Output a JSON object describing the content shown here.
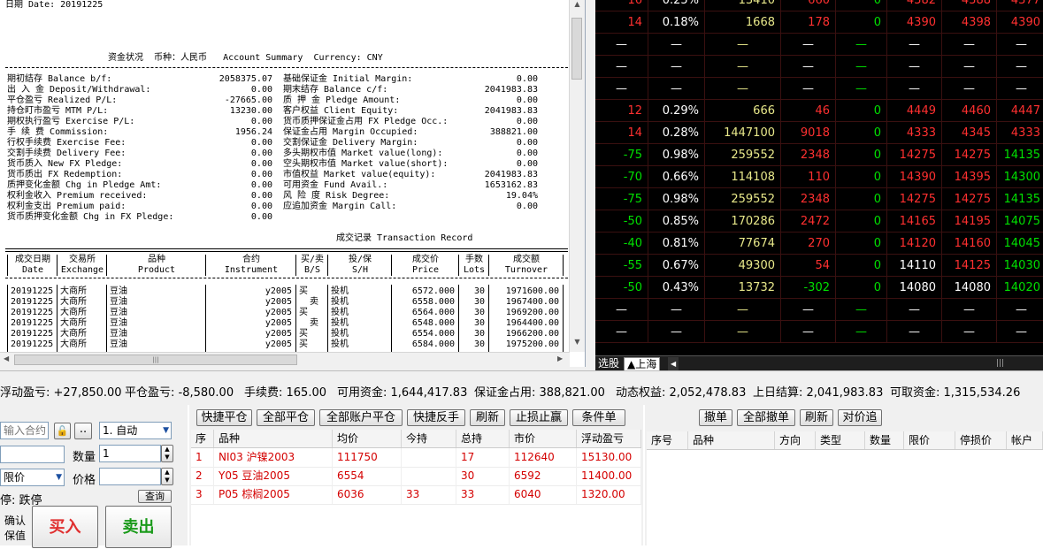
{
  "statement": {
    "date_line": "日期 Date: 20191225",
    "summary_title": "资金状况  币种：人民币   Account Summary  Currency: CNY",
    "left_rows": [
      {
        "label": "期初结存 Balance b/f:",
        "value": "2058375.07"
      },
      {
        "label": "出 入 金 Deposit/Withdrawal:",
        "value": "0.00"
      },
      {
        "label": "平仓盈亏 Realized P/L:",
        "value": "-27665.00"
      },
      {
        "label": "持仓盯市盈亏 MTM P/L:",
        "value": "13230.00"
      },
      {
        "label": "期权执行盈亏 Exercise P/L:",
        "value": "0.00"
      },
      {
        "label": "手 续 费 Commission:",
        "value": "1956.24"
      },
      {
        "label": "行权手续费 Exercise Fee:",
        "value": "0.00"
      },
      {
        "label": "交割手续费 Delivery Fee:",
        "value": "0.00"
      },
      {
        "label": "货币质入 New FX Pledge:",
        "value": "0.00"
      },
      {
        "label": "货币质出 FX Redemption:",
        "value": "0.00"
      },
      {
        "label": "质押变化金额 Chg in Pledge Amt:",
        "value": "0.00"
      },
      {
        "label": "权利金收入 Premium received:",
        "value": "0.00"
      },
      {
        "label": "权利金支出 Premium paid:",
        "value": "0.00"
      },
      {
        "label": "货币质押变化金额 Chg in FX Pledge:",
        "value": "0.00"
      }
    ],
    "right_rows": [
      {
        "label": "基础保证金 Initial Margin:",
        "value": "0.00"
      },
      {
        "label": "期末结存 Balance c/f:",
        "value": "2041983.83"
      },
      {
        "label": "质 押 金 Pledge Amount:",
        "value": "0.00"
      },
      {
        "label": "客户权益 Client Equity:",
        "value": "2041983.83"
      },
      {
        "label": "货币质押保证金占用 FX Pledge Occ.:",
        "value": "0.00"
      },
      {
        "label": "保证金占用 Margin Occupied:",
        "value": "388821.00"
      },
      {
        "label": "交割保证金 Delivery Margin:",
        "value": "0.00"
      },
      {
        "label": "多头期权市值 Market value(long):",
        "value": "0.00"
      },
      {
        "label": "空头期权市值 Market value(short):",
        "value": "0.00"
      },
      {
        "label": "市值权益 Market value(equity):",
        "value": "2041983.83"
      },
      {
        "label": "可用资金 Fund Avail.:",
        "value": "1653162.83"
      },
      {
        "label": "风 险 度 Risk Degree:",
        "value": "19.04%"
      },
      {
        "label": "应追加资金 Margin Call:",
        "value": "0.00"
      }
    ],
    "trade_title": "成交记录 Transaction Record",
    "trade_headers": [
      {
        "cn": "成交日期",
        "en": "Date"
      },
      {
        "cn": "交易所",
        "en": "Exchange"
      },
      {
        "cn": "品种",
        "en": "Product"
      },
      {
        "cn": "合约",
        "en": "Instrument"
      },
      {
        "cn": "买/卖",
        "en": "B/S"
      },
      {
        "cn": "投/保",
        "en": "S/H"
      },
      {
        "cn": "成交价",
        "en": "Price"
      },
      {
        "cn": "手数",
        "en": "Lots"
      },
      {
        "cn": "成交额",
        "en": "Turnover"
      }
    ],
    "trades": [
      {
        "date": "20191225",
        "exch": "大商所",
        "prod": "豆油",
        "inst": "y2005",
        "bs": "买",
        "sh": "投机",
        "price": "6572.000",
        "lots": "30",
        "turnover": "1971600.00"
      },
      {
        "date": "20191225",
        "exch": "大商所",
        "prod": "豆油",
        "inst": "y2005",
        "bs": "  卖",
        "sh": "投机",
        "price": "6558.000",
        "lots": "30",
        "turnover": "1967400.00"
      },
      {
        "date": "20191225",
        "exch": "大商所",
        "prod": "豆油",
        "inst": "y2005",
        "bs": "买",
        "sh": "投机",
        "price": "6564.000",
        "lots": "30",
        "turnover": "1969200.00"
      },
      {
        "date": "20191225",
        "exch": "大商所",
        "prod": "豆油",
        "inst": "y2005",
        "bs": "  卖",
        "sh": "投机",
        "price": "6548.000",
        "lots": "30",
        "turnover": "1964400.00"
      },
      {
        "date": "20191225",
        "exch": "大商所",
        "prod": "豆油",
        "inst": "y2005",
        "bs": "买",
        "sh": "投机",
        "price": "6554.000",
        "lots": "30",
        "turnover": "1966200.00"
      },
      {
        "date": "20191225",
        "exch": "大商所",
        "prod": "豆油",
        "inst": "y2005",
        "bs": "买",
        "sh": "投机",
        "price": "6584.000",
        "lots": "30",
        "turnover": "1975200.00"
      }
    ]
  },
  "quotes": {
    "rows": [
      {
        "chg": "16",
        "pct": "0.25%",
        "vol": "13410",
        "oi": "660",
        "z": "0",
        "a": "4382",
        "b": "4388",
        "c": "4377",
        "dir": "up"
      },
      {
        "chg": "14",
        "pct": "0.18%",
        "vol": "1668",
        "oi": "178",
        "z": "0",
        "a": "4390",
        "b": "4398",
        "c": "4390",
        "dir": "up"
      },
      {
        "chg": "—",
        "pct": "—",
        "vol": "—",
        "oi": "—",
        "z": "—",
        "a": "—",
        "b": "—",
        "c": "—",
        "dir": "none"
      },
      {
        "chg": "—",
        "pct": "—",
        "vol": "—",
        "oi": "—",
        "z": "—",
        "a": "—",
        "b": "—",
        "c": "—",
        "dir": "none"
      },
      {
        "chg": "—",
        "pct": "—",
        "vol": "—",
        "oi": "—",
        "z": "—",
        "a": "—",
        "b": "—",
        "c": "—",
        "dir": "none"
      },
      {
        "chg": "12",
        "pct": "0.29%",
        "vol": "666",
        "oi": "46",
        "z": "0",
        "a": "4449",
        "b": "4460",
        "c": "4447",
        "dir": "up"
      },
      {
        "chg": "14",
        "pct": "0.28%",
        "vol": "1447100",
        "oi": "9018",
        "z": "0",
        "a": "4333",
        "b": "4345",
        "c": "4333",
        "dir": "up"
      },
      {
        "chg": "-75",
        "pct": "0.98%",
        "vol": "259552",
        "oi": "2348",
        "z": "0",
        "a": "14275",
        "b": "14275",
        "c": "14135",
        "dir": "down"
      },
      {
        "chg": "-70",
        "pct": "0.66%",
        "vol": "114108",
        "oi": "110",
        "z": "0",
        "a": "14390",
        "b": "14395",
        "c": "14300",
        "dir": "down"
      },
      {
        "chg": "-75",
        "pct": "0.98%",
        "vol": "259552",
        "oi": "2348",
        "z": "0",
        "a": "14275",
        "b": "14275",
        "c": "14135",
        "dir": "down"
      },
      {
        "chg": "-50",
        "pct": "0.85%",
        "vol": "170286",
        "oi": "2472",
        "z": "0",
        "a": "14165",
        "b": "14195",
        "c": "14075",
        "dir": "down"
      },
      {
        "chg": "-40",
        "pct": "0.81%",
        "vol": "77674",
        "oi": "270",
        "z": "0",
        "a": "14120",
        "b": "14160",
        "c": "14045",
        "dir": "down"
      },
      {
        "chg": "-55",
        "pct": "0.67%",
        "vol": "49300",
        "oi": "54",
        "z": "0",
        "a": "14110",
        "b": "14125",
        "c": "14030",
        "dir": "down2"
      },
      {
        "chg": "-50",
        "pct": "0.43%",
        "vol": "13732",
        "oi": "-302",
        "z": "0",
        "a": "14080",
        "b": "14080",
        "c": "14020",
        "dir": "down3"
      },
      {
        "chg": "—",
        "pct": "—",
        "vol": "—",
        "oi": "—",
        "z": "—",
        "a": "—",
        "b": "—",
        "c": "—",
        "dir": "none"
      },
      {
        "chg": "—",
        "pct": "—",
        "vol": "—",
        "oi": "—",
        "z": "—",
        "a": "—",
        "b": "—",
        "c": "—",
        "dir": "none"
      }
    ],
    "tab_left": "选股",
    "tab_selected": "▲上海"
  },
  "account": {
    "float_pl": "浮动盈亏: +27,850.00",
    "close_pl": "平仓盈亏: -8,580.00",
    "fee": "手续费: 165.00",
    "avail": "可用资金: 1,644,417.83",
    "margin": "保证金占用: 388,821.00",
    "equity": "动态权益: 2,052,478.83",
    "prev": "上日结算: 2,041,983.83",
    "withdraw": "可取资金: 1,315,534.26"
  },
  "order": {
    "contract_placeholder": "输入合约",
    "mode": "1. 自动",
    "qty_label": "数量",
    "qty": "1",
    "type": "限价",
    "price_label": "价格",
    "limit_label": "停:  跌停",
    "query": "查询",
    "confirm": "确认",
    "keep": "保值",
    "buy": "买入",
    "sell": "卖出"
  },
  "positions": {
    "toolbar": [
      "快捷平仓",
      "全部平仓",
      "全部账户平仓",
      "快捷反手",
      "刷新",
      "止损止赢",
      "条件单"
    ],
    "headers": [
      "序",
      "品种",
      "均价",
      "今持",
      "总持",
      "市价",
      "浮动盈亏"
    ],
    "rows": [
      {
        "n": "1",
        "name": "NI03 沪镍2003",
        "avg": "111750",
        "today": "",
        "total": "17",
        "mkt": "112640",
        "pl": "15130.00"
      },
      {
        "n": "2",
        "name": "Y05 豆油2005",
        "avg": "6554",
        "today": "",
        "total": "30",
        "mkt": "6592",
        "pl": "11400.00"
      },
      {
        "n": "3",
        "name": "P05 棕榈2005",
        "avg": "6036",
        "today": "33",
        "total": "33",
        "mkt": "6040",
        "pl": "1320.00"
      }
    ]
  },
  "pending": {
    "toolbar": [
      "撤单",
      "全部撤单",
      "刷新",
      "对价追"
    ],
    "headers": [
      "序号",
      "品种",
      "方向",
      "类型",
      "数量",
      "限价",
      "停损价",
      "帐户"
    ]
  },
  "colors": {
    "up": "#ff3030",
    "down": "#00e000",
    "yellow": "#e8e88a",
    "white": "#ffffff",
    "cyan": "#44e0e0"
  }
}
